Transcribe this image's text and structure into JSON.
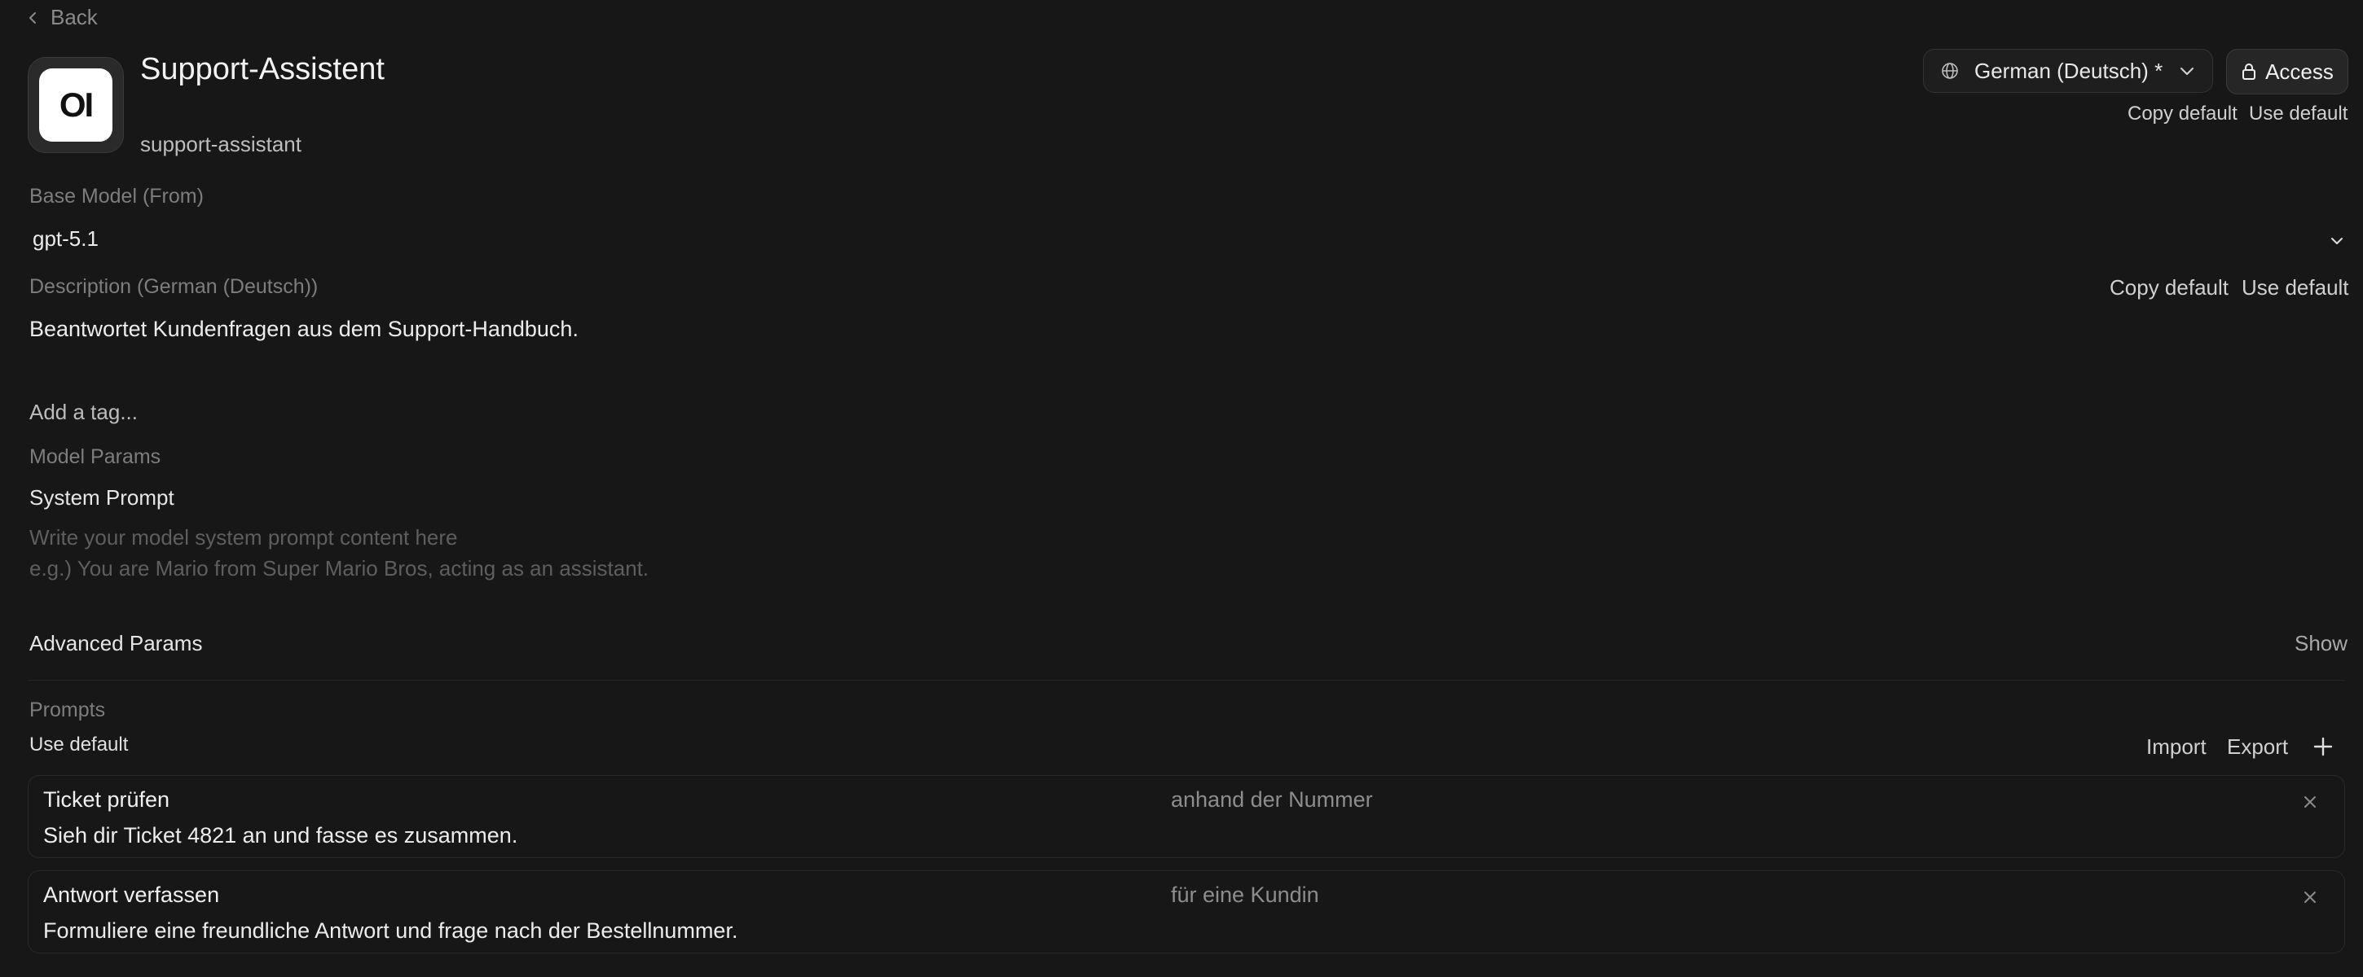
{
  "nav": {
    "back_label": "Back"
  },
  "model": {
    "avatar_text": "OI",
    "name": "Support-Assistent",
    "slug": "support-assistant"
  },
  "language": {
    "selected": "German (Deutsch) *"
  },
  "access": {
    "label": "Access"
  },
  "header_actions": {
    "copy_default": "Copy default",
    "use_default": "Use default"
  },
  "base_model": {
    "label": "Base Model (From)",
    "value": "gpt-5.1"
  },
  "description": {
    "label": "Description (German (Deutsch))",
    "copy_default": "Copy default",
    "use_default": "Use default",
    "value": "Beantwortet Kundenfragen aus dem Support-Handbuch."
  },
  "tags": {
    "placeholder": "Add a tag..."
  },
  "model_params": {
    "label": "Model Params",
    "system_prompt_label": "System Prompt",
    "system_prompt_placeholder_line1": "Write your model system prompt content here",
    "system_prompt_placeholder_line2": "e.g.) You are Mario from Super Mario Bros, acting as an assistant."
  },
  "advanced": {
    "label": "Advanced Params",
    "toggle": "Show"
  },
  "prompts": {
    "label": "Prompts",
    "use_default": "Use default",
    "import_label": "Import",
    "export_label": "Export",
    "items": [
      {
        "command": "Ticket prüfen",
        "hint": "anhand der Nummer",
        "content": "Sieh dir Ticket 4821 an und fasse es zusammen."
      },
      {
        "command": "Antwort verfassen",
        "hint": "für eine Kundin",
        "content": "Formuliere eine freundliche Antwort und frage nach der Bestellnummer."
      }
    ]
  },
  "icons": {
    "back": "chevron-left-icon",
    "globe": "globe-icon",
    "chevron_down": "chevron-down-icon",
    "lock": "lock-icon",
    "plus": "plus-icon",
    "close": "close-icon"
  }
}
